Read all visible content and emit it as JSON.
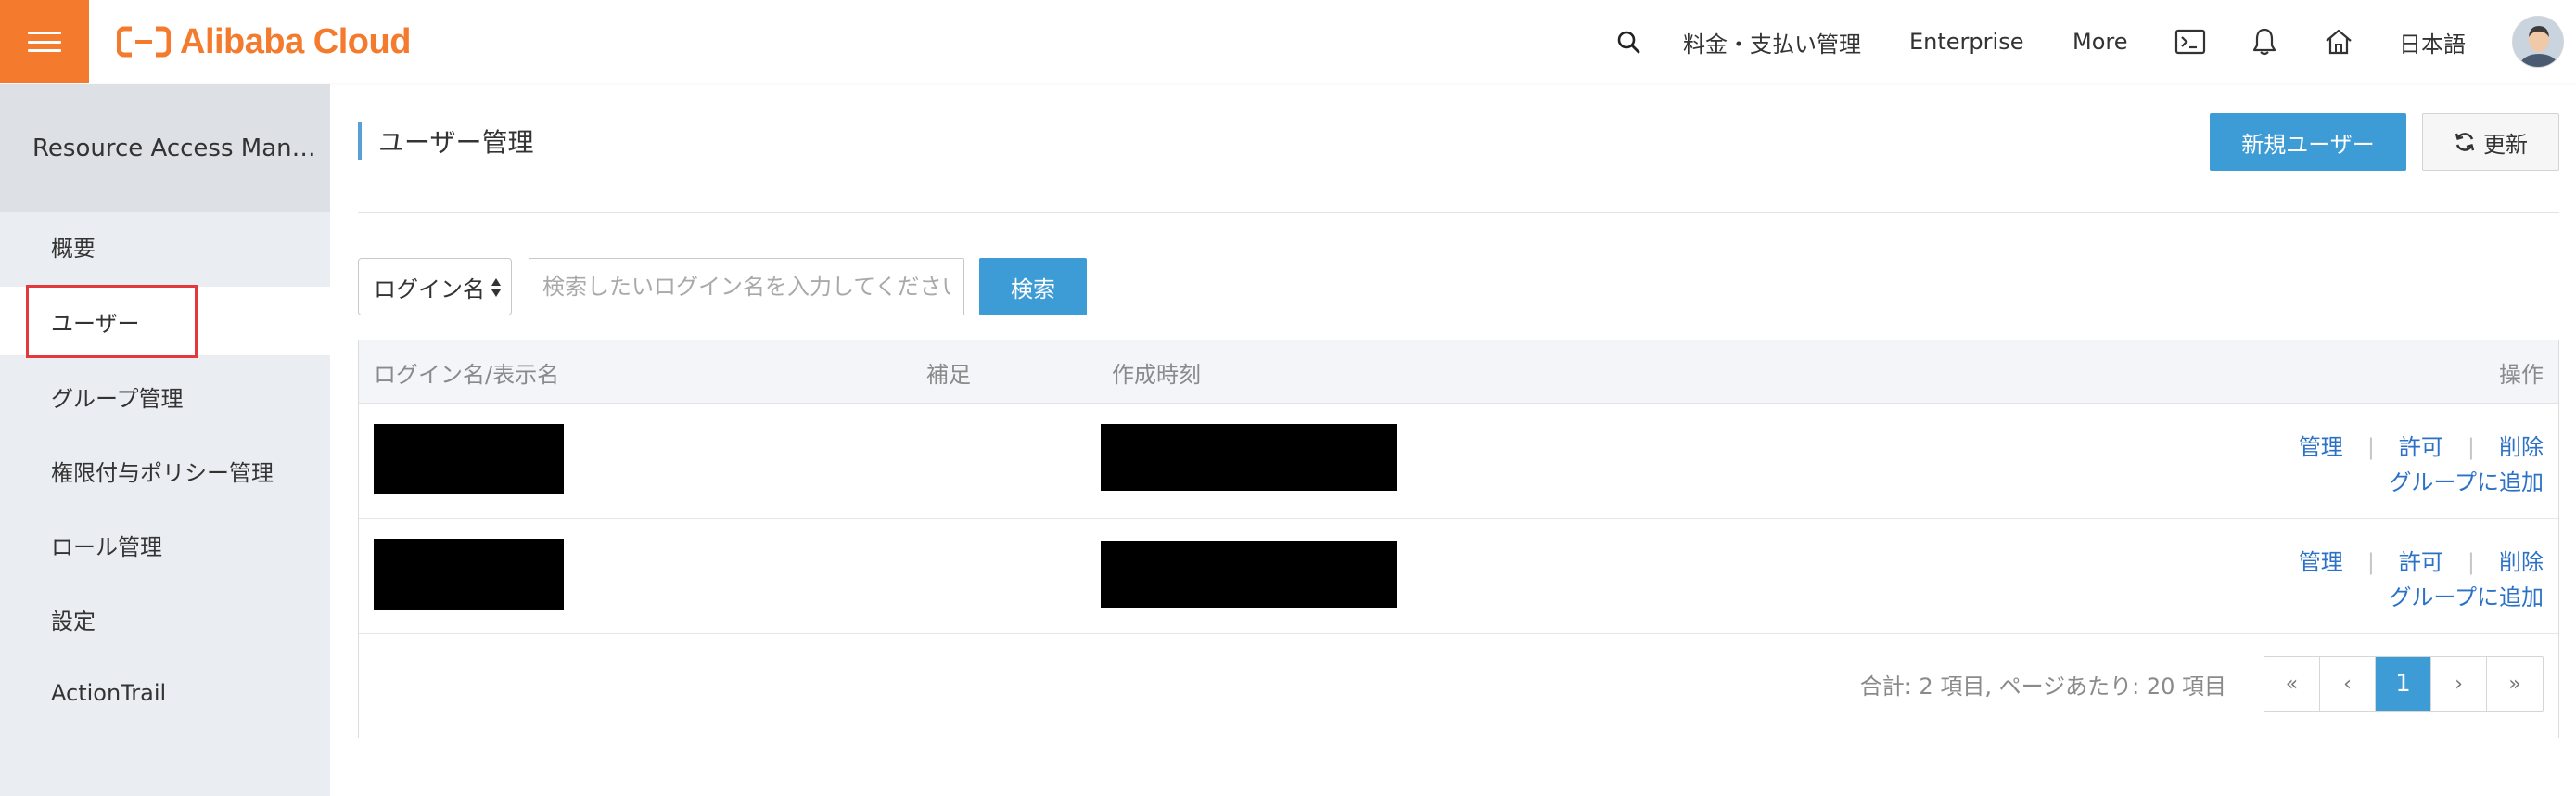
{
  "header": {
    "brand": "Alibaba Cloud",
    "nav": {
      "billing": "料金・支払い管理",
      "enterprise": "Enterprise",
      "more": "More",
      "language": "日本語"
    },
    "icons": [
      "search-icon",
      "terminal-icon",
      "bell-icon",
      "home-icon"
    ],
    "accent_color": "#f47b2d"
  },
  "sidebar": {
    "title": "Resource Access Man…",
    "items": [
      {
        "label": "概要"
      },
      {
        "label": "ユーザー",
        "active": true
      },
      {
        "label": "グループ管理"
      },
      {
        "label": "権限付与ポリシー管理"
      },
      {
        "label": "ロール管理"
      },
      {
        "label": "設定"
      },
      {
        "label": "ActionTrail"
      }
    ]
  },
  "main": {
    "title": "ユーザー管理",
    "new_user_button": "新規ユーザー",
    "refresh_button": "更新",
    "filter": {
      "selected": "ログイン名",
      "placeholder": "検索したいログイン名を入力してください",
      "search_button": "検索"
    },
    "table": {
      "columns": [
        "ログイン名/表示名",
        "補足",
        "作成時刻",
        "操作"
      ],
      "rows": [
        {
          "login": "",
          "note": "",
          "created": "",
          "actions": [
            "管理",
            "許可",
            "削除",
            "グループに追加"
          ]
        },
        {
          "login": "",
          "note": "",
          "created": "",
          "actions": [
            "管理",
            "許可",
            "削除",
            "グループに追加"
          ]
        }
      ]
    },
    "pagination": {
      "summary": "合計: 2 項目, ページあたり: 20 項目",
      "first": "«",
      "prev": "‹",
      "current": "1",
      "next": "›",
      "last": "»"
    },
    "primary_color": "#3d9bd5",
    "link_color": "#2b72c7"
  }
}
